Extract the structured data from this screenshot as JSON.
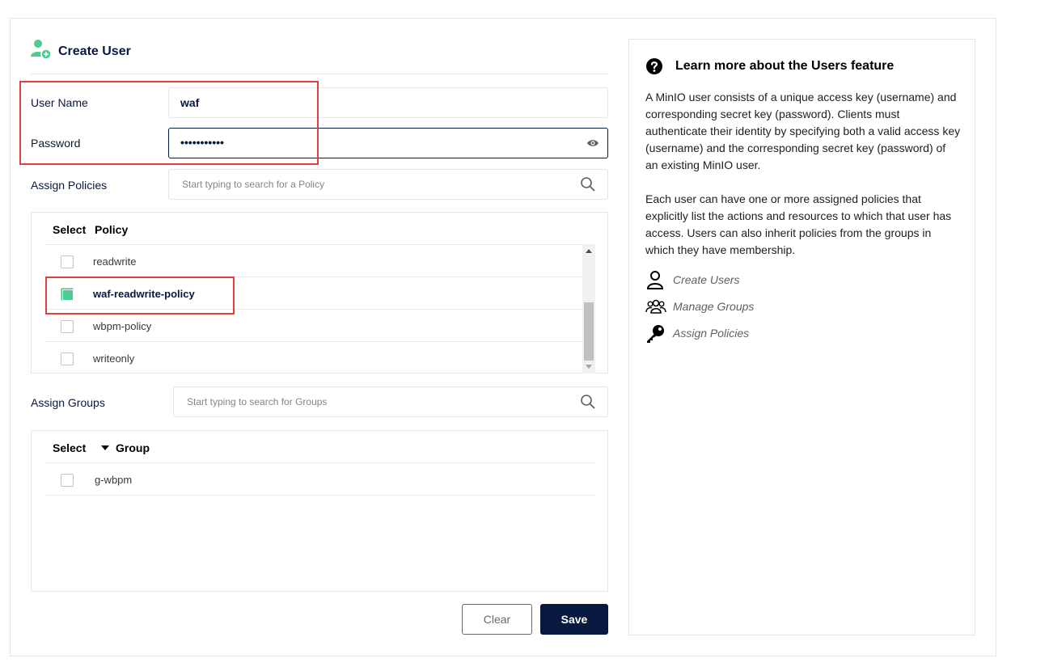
{
  "header": {
    "title": "Create User",
    "icon": "add-user-icon"
  },
  "form": {
    "username_label": "User Name",
    "username_value": "waf",
    "password_label": "Password",
    "password_value": "•••••••••••",
    "assign_policies_label": "Assign Policies",
    "policy_search_placeholder": "Start typing to search for a Policy",
    "assign_groups_label": "Assign Groups",
    "group_search_placeholder": "Start typing to search for Groups"
  },
  "policies_table": {
    "headers": {
      "select": "Select",
      "policy": "Policy"
    },
    "rows": [
      {
        "name": "readwrite",
        "checked": false
      },
      {
        "name": "waf-readwrite-policy",
        "checked": true
      },
      {
        "name": "wbpm-policy",
        "checked": false
      },
      {
        "name": "writeonly",
        "checked": false
      }
    ]
  },
  "groups_table": {
    "headers": {
      "select": "Select",
      "group": "Group"
    },
    "rows": [
      {
        "name": "g-wbpm",
        "checked": false
      }
    ]
  },
  "buttons": {
    "clear": "Clear",
    "save": "Save"
  },
  "help": {
    "title": "Learn more about the Users feature",
    "paragraph1": "A MinIO user consists of a unique access key (username) and corresponding secret key (password). Clients must authenticate their identity by specifying both a valid access key (username) and the corresponding secret key (password) of an existing MinIO user.",
    "paragraph2": "Each user can have one or more assigned policies that explicitly list the actions and resources to which that user has access. Users can also inherit policies from the groups in which they have membership.",
    "links": [
      {
        "label": "Create Users",
        "icon": "user-icon"
      },
      {
        "label": "Manage Groups",
        "icon": "groups-icon"
      },
      {
        "label": "Assign Policies",
        "icon": "key-icon"
      }
    ]
  },
  "colors": {
    "accent": "#4ccb92",
    "navy": "#07193e",
    "highlight": "#e53e3e"
  }
}
